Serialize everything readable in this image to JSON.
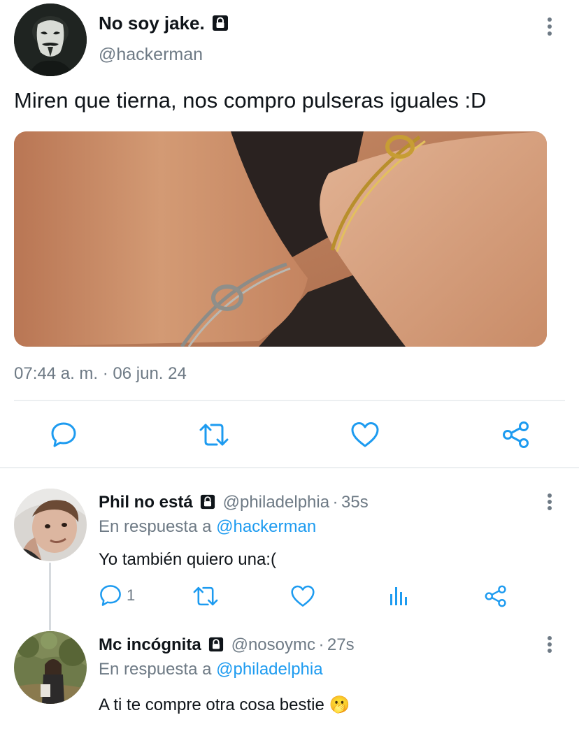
{
  "tweet": {
    "author_name": "No soy jake.",
    "author_handle": "@hackerman",
    "text": "Miren que tierna, nos compro pulseras iguales :D",
    "timestamp": "07:44 a. m. · 06 jun. 24",
    "avatar_icon": "anonymous-mask-avatar",
    "media_description_icon": "bracelets-photo"
  },
  "actions": {
    "reply_icon": "reply-icon",
    "retweet_icon": "retweet-icon",
    "like_icon": "heart-icon",
    "share_icon": "share-icon"
  },
  "replies": [
    {
      "author_name": "Phil no está",
      "author_handle": "@philadelphia",
      "separator": "·",
      "time": "35s",
      "reply_prefix": "En respuesta a",
      "reply_to": "@hackerman",
      "text": "Yo también quiero una:(",
      "reply_count": "1"
    },
    {
      "author_name": "Mc incógnita",
      "author_handle": "@nosoymc",
      "separator": "·",
      "time": "27s",
      "reply_prefix": "En respuesta a",
      "reply_to": "@philadelphia",
      "text": "A ti te compre otra cosa bestie",
      "emoji": "🫢"
    }
  ],
  "colors": {
    "text": "#0f1419",
    "secondary": "#6e7a85",
    "link": "#1d9bf0",
    "divider": "#eceff1",
    "icon": "#1d9bf0"
  }
}
